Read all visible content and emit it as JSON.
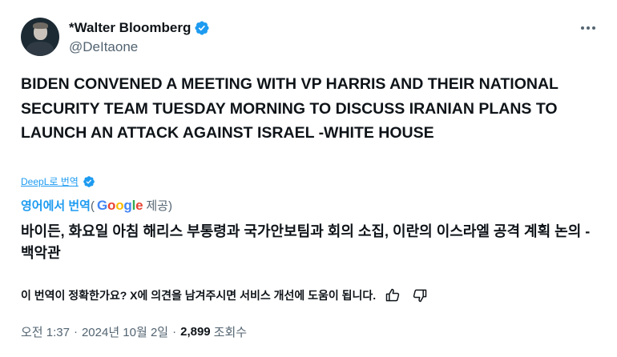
{
  "author": {
    "display_name": "*Walter Bloomberg",
    "handle": "@DeItaone",
    "verified": true
  },
  "tweet": {
    "text": "BIDEN CONVENED A MEETING WITH VP HARRIS AND THEIR NATIONAL SECURITY TEAM TUESDAY MORNING TO DISCUSS IRANIAN PLANS TO LAUNCH AN ATTACK AGAINST ISRAEL -WHITE HOUSE"
  },
  "deepl": {
    "label": "DeepL로 번역"
  },
  "google_translate": {
    "link": "영어에서 번역",
    "paren_open": "(",
    "logo": [
      "G",
      "o",
      "o",
      "g",
      "l",
      "e"
    ],
    "provided": " 제공)"
  },
  "translation": {
    "text": "바이든, 화요일 아침 해리스 부통령과 국가안보팀과 회의 소집, 이란의 이스라엘 공격 계획 논의 - 백악관"
  },
  "feedback": {
    "prompt": "이 번역이 정확한가요? X에 의견을 남겨주시면 서비스 개선에 도움이 됩니다."
  },
  "meta": {
    "time": "오전 1:37",
    "separator": "·",
    "date": "2024년 10월 2일",
    "views_count": "2,899",
    "views_label": "조회수"
  },
  "colors": {
    "accent": "#1d9bf0",
    "secondary_text": "#536471",
    "primary_text": "#0f1419"
  }
}
